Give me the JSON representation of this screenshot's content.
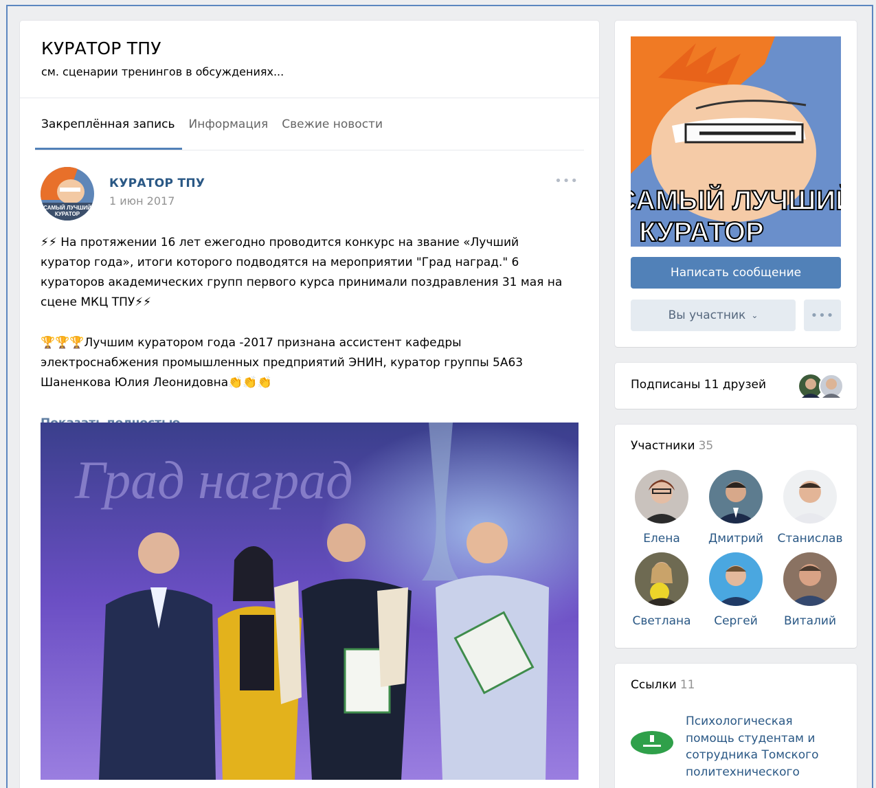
{
  "group": {
    "title": "КУРАТОР ТПУ",
    "status": "см. сценарии тренингов в обсуждениях..."
  },
  "tabs": [
    {
      "label": "Закреплённая запись",
      "active": true
    },
    {
      "label": "Информация",
      "active": false
    },
    {
      "label": "Свежие новости",
      "active": false
    }
  ],
  "post": {
    "author": "КУРАТОР ТПУ",
    "date": "1 июн 2017",
    "more_icon": "•••",
    "paragraph1": "⚡⚡ На протяжении 16 лет ежегодно проводится конкурс на звание «Лучший куратор года», итоги которого подводятся на мероприятии \"Град наград.\" 6 кураторов академических групп первого курса принимали поздравления 31 мая на сцене МКЦ ТПУ⚡⚡",
    "paragraph2": "🏆🏆🏆Лучшим куратором года -2017 признана ассистент кафедры электроснабжения промышленных предприятий ЭНИН, куратор группы 5А63 Шаненкова Юлия Леонидовна👏👏👏",
    "show_more": "Показать полностью…",
    "photo_banner": "Град наград"
  },
  "cover": {
    "caption_line1": "САМЫЙ ЛУЧШИЙ",
    "caption_line2": "КУРАТОР"
  },
  "avatar_caption": {
    "line1": "САМЫЙ ЛУЧШИЙ",
    "line2": "КУРАТОР"
  },
  "actions": {
    "write_message": "Написать сообщение",
    "member_status": "Вы участник",
    "more": "•••"
  },
  "friends": {
    "label": "Подписаны 11 друзей"
  },
  "members": {
    "label": "Участники",
    "count": "35",
    "items": [
      {
        "name": "Елена"
      },
      {
        "name": "Дмитрий"
      },
      {
        "name": "Станислав"
      },
      {
        "name": "Светлана"
      },
      {
        "name": "Сергей"
      },
      {
        "name": "Виталий"
      }
    ]
  },
  "links": {
    "label": "Ссылки",
    "count": "11",
    "items": [
      {
        "text": "Психологическая помощь студентам и сотрудника Томского политехнического"
      }
    ]
  },
  "colors": {
    "accent": "#5181b8",
    "link": "#2a5885",
    "background": "#edeef0"
  }
}
